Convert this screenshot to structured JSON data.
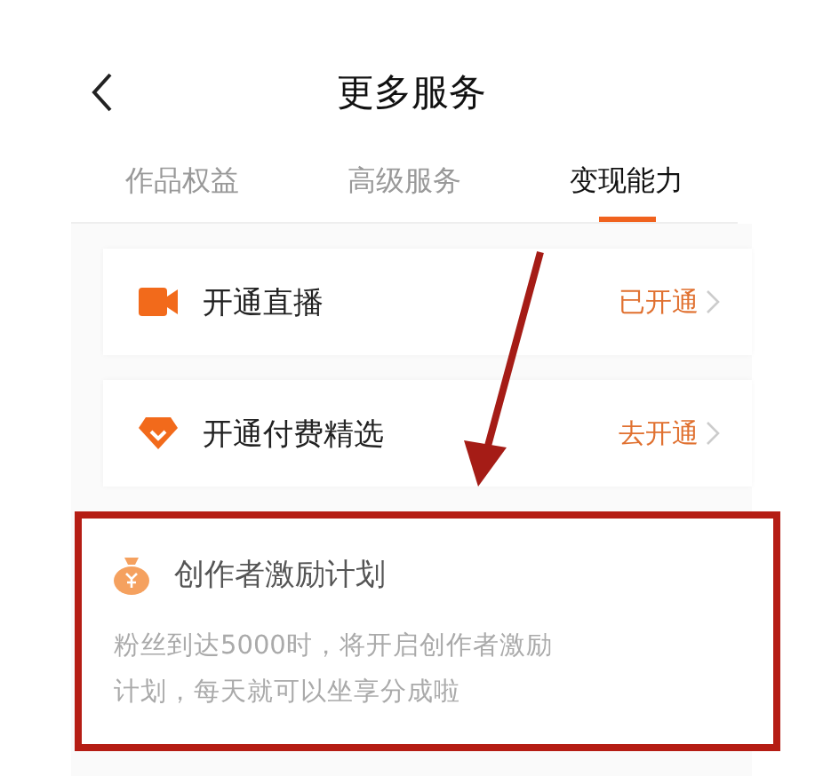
{
  "header": {
    "title": "更多服务"
  },
  "tabs": [
    {
      "label": "作品权益",
      "selected": false
    },
    {
      "label": "高级服务",
      "selected": false
    },
    {
      "label": "变现能力",
      "selected": true
    }
  ],
  "services": [
    {
      "kind": "row",
      "title": "开通直播",
      "action": "已开通"
    },
    {
      "kind": "row",
      "title": "开通付费精选",
      "action": "去开通"
    },
    {
      "kind": "plan",
      "title": "创作者激励计划",
      "description": "粉丝到达5000时，将开启创作者激励计划，每天就可以坐享分成啦",
      "highlighted": true
    }
  ],
  "annotation_arrow": true
}
